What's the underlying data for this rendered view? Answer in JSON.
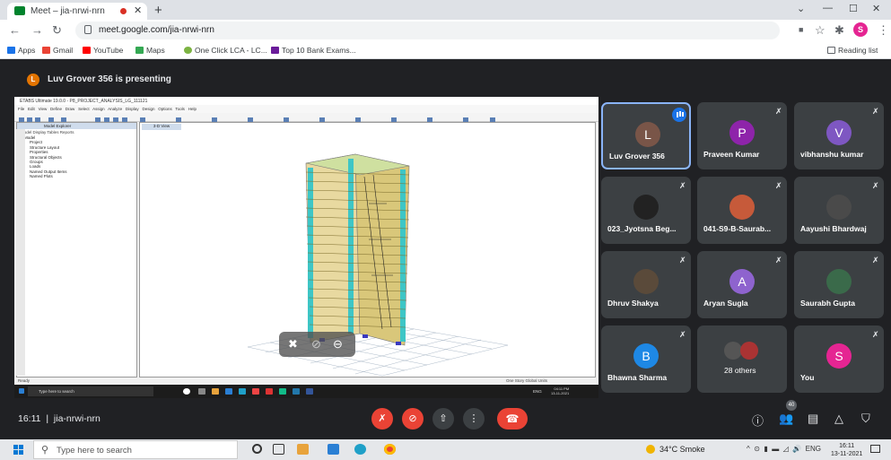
{
  "browser": {
    "tab_title": "Meet – jia-nrwi-nrn",
    "url": "meet.google.com/jia-nrwi-nrn",
    "profile_initial": "S",
    "bookmarks": [
      {
        "label": "Apps",
        "color": "#1a73e8"
      },
      {
        "label": "Gmail",
        "color": "#ea4335"
      },
      {
        "label": "YouTube",
        "color": "#ff0000"
      },
      {
        "label": "Maps",
        "color": "#34a853"
      },
      {
        "label": "One Click LCA - LC...",
        "color": "#7cb342"
      },
      {
        "label": "Top 10 Bank Exams...",
        "color": "#6a1b9a"
      }
    ],
    "reading_list": "Reading list"
  },
  "meet": {
    "presenter_initial": "L",
    "presenting_text": "Luv Grover 356 is presenting",
    "time": "16:11",
    "meeting_code": "jia-nrwi-nrn",
    "people_count": "40",
    "participants": [
      {
        "name": "Luv Grover 356",
        "initial": "L",
        "avatar_color": "#795548",
        "speaking": true
      },
      {
        "name": "Praveen Kumar",
        "initial": "P",
        "avatar_color": "#8e24aa"
      },
      {
        "name": "vibhanshu kumar",
        "initial": "V",
        "avatar_color": "#7e57c2"
      },
      {
        "name": "023_Jyotsna Beg...",
        "photo": true
      },
      {
        "name": "041-S9-B-Saurab...",
        "photo": true
      },
      {
        "name": "Aayushi Bhardwaj",
        "photo": true
      },
      {
        "name": "Dhruv Shakya",
        "photo": true
      },
      {
        "name": "Aryan Sugla",
        "initial": "A",
        "avatar_color": "#8e63ce"
      },
      {
        "name": "Saurabh Gupta",
        "photo": true
      },
      {
        "name": "Bhawna Sharma",
        "initial": "B",
        "avatar_color": "#1e88e5"
      },
      {
        "name": "28 others",
        "photo": true
      },
      {
        "name": "You",
        "initial": "S",
        "avatar_color": "#e52592"
      }
    ]
  },
  "shared_screen": {
    "etabs_title": "ETABS Ultimate 19.0.0 - P8_PROJECT_ANALYSIS_LG_111121",
    "menu": [
      "File",
      "Edit",
      "View",
      "Define",
      "Draw",
      "Select",
      "Assign",
      "Analyze",
      "Display",
      "Design",
      "Options",
      "Tools",
      "Help"
    ],
    "explorer_title": "Model Explorer",
    "explorer_tabs": "Model   Display   Tables   Reports",
    "tree": [
      "Model",
      "Project",
      "Structure Layout",
      "Properties",
      "Structural Objects",
      "Groups",
      "Loads",
      "Named Output Items",
      "Named Plots"
    ],
    "view_tab": "3-D View",
    "status_left": "Ready",
    "status_right": "One Story   Global   Units",
    "search_text": "Type here to search",
    "clock": "04:11 PM\n13-11-2021",
    "lang": "ENG"
  },
  "taskbar": {
    "search_text": "Type here to search",
    "weather": "34°C  Smoke",
    "lang": "ENG",
    "time": "16:11",
    "date": "13-11-2021"
  }
}
